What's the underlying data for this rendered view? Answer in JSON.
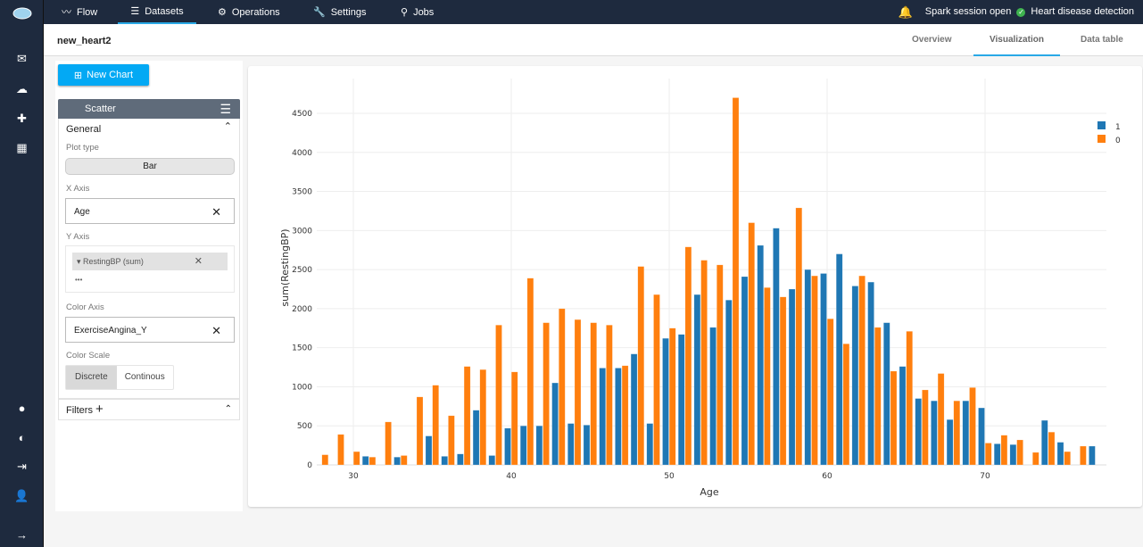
{
  "nav": {
    "items": [
      {
        "label": "Flow",
        "icon": "trend-icon"
      },
      {
        "label": "Datasets",
        "icon": "list-icon"
      },
      {
        "label": "Operations",
        "icon": "gear-icon"
      },
      {
        "label": "Settings",
        "icon": "wrench-icon"
      },
      {
        "label": "Jobs",
        "icon": "jobs-icon"
      }
    ],
    "active": "Datasets"
  },
  "status": {
    "session": "Spark session open",
    "project": "Heart disease detection"
  },
  "dataset": {
    "title": "new_heart2"
  },
  "tabs": [
    {
      "label": "Overview"
    },
    {
      "label": "Visualization"
    },
    {
      "label": "Data table"
    }
  ],
  "panel": {
    "new_chart": "New Chart",
    "chart_kind": "Scatter",
    "general": "General",
    "plot_type_label": "Plot type",
    "plot_type": "Bar",
    "x_axis_label": "X Axis",
    "x_axis": "Age",
    "y_axis_label": "Y Axis",
    "y_axis": "RestingBP (sum)",
    "more": "•••",
    "color_axis_label": "Color Axis",
    "color_axis": "ExerciseAngina_Y",
    "color_scale_label": "Color Scale",
    "scale_discrete": "Discrete",
    "scale_continuous": "Continous",
    "filters": "Filters"
  },
  "chart_data": {
    "type": "bar",
    "xlabel": "Age",
    "ylabel": "sum(RestingBP)",
    "xticks": [
      30,
      40,
      50,
      60,
      70
    ],
    "yticks": [
      0,
      500,
      1000,
      1500,
      2000,
      2500,
      3000,
      3500,
      4000,
      4500
    ],
    "ylim": [
      0,
      4800
    ],
    "grid": true,
    "legend_position": "top-right",
    "x": [
      28,
      29,
      30,
      31,
      32,
      33,
      34,
      35,
      36,
      37,
      38,
      39,
      40,
      41,
      42,
      43,
      44,
      45,
      46,
      47,
      48,
      49,
      50,
      51,
      52,
      53,
      54,
      55,
      56,
      57,
      58,
      59,
      60,
      61,
      62,
      63,
      64,
      65,
      66,
      67,
      68,
      69,
      70,
      71,
      72,
      73,
      74,
      75,
      76,
      77
    ],
    "series": [
      {
        "name": "1",
        "color": "#1f77b4",
        "values": [
          0,
          0,
          0,
          110,
          0,
          100,
          0,
          370,
          110,
          140,
          700,
          120,
          470,
          500,
          500,
          1050,
          530,
          510,
          1240,
          1240,
          1420,
          530,
          1620,
          1670,
          2180,
          1760,
          2110,
          2410,
          2810,
          3030,
          2250,
          2500,
          2450,
          2700,
          2290,
          2340,
          1820,
          1260,
          850,
          820,
          580,
          820,
          730,
          270,
          260,
          0,
          570,
          290,
          0,
          240
        ]
      },
      {
        "name": "0",
        "color": "#ff7f0e",
        "values": [
          130,
          390,
          170,
          100,
          550,
          120,
          870,
          1020,
          630,
          1260,
          1220,
          1790,
          1190,
          2390,
          1820,
          2000,
          1860,
          1820,
          1790,
          1270,
          2540,
          2180,
          1750,
          2790,
          2620,
          2560,
          4700,
          3100,
          2270,
          2150,
          3290,
          2420,
          1870,
          1550,
          2420,
          1760,
          1200,
          1710,
          960,
          1170,
          820,
          990,
          280,
          380,
          320,
          160,
          420,
          170,
          240,
          0
        ]
      }
    ]
  }
}
